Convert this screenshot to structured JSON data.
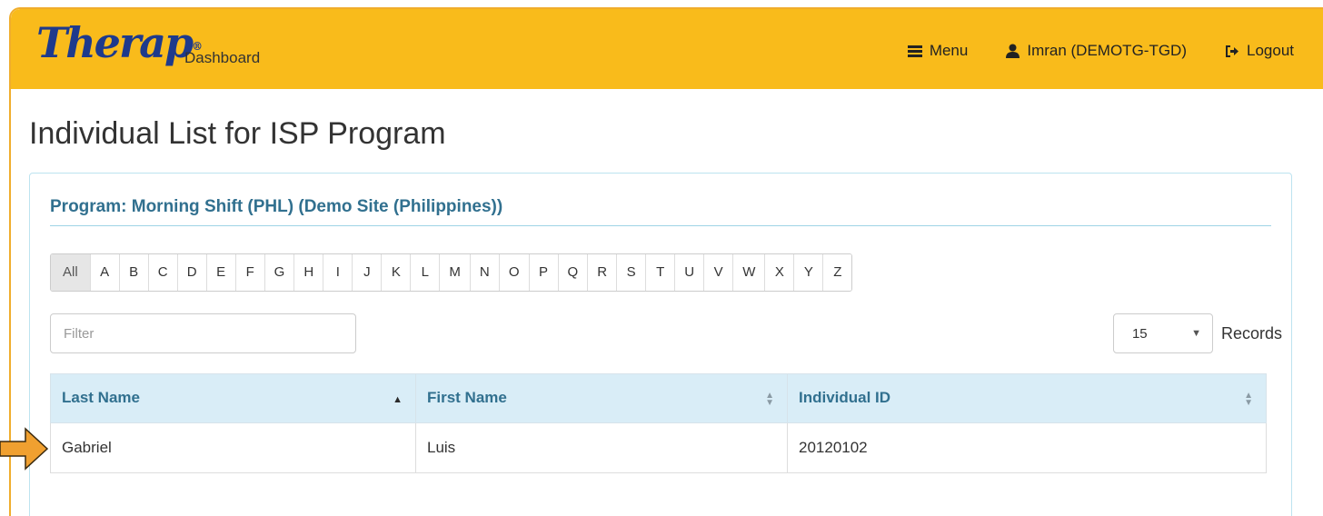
{
  "header": {
    "logo_text": "Therap",
    "logo_mark": "®",
    "dashboard_label": "Dashboard",
    "menu_label": "Menu",
    "user_label": "Imran (DEMOTG-TGD)",
    "logout_label": "Logout"
  },
  "page": {
    "title": "Individual List for ISP Program",
    "program_label": "Program: Morning Shift (PHL) (Demo Site (Philippines))"
  },
  "alphabet": [
    "All",
    "A",
    "B",
    "C",
    "D",
    "E",
    "F",
    "G",
    "H",
    "I",
    "J",
    "K",
    "L",
    "M",
    "N",
    "O",
    "P",
    "Q",
    "R",
    "S",
    "T",
    "U",
    "V",
    "W",
    "X",
    "Y",
    "Z"
  ],
  "filter": {
    "placeholder": "Filter",
    "value": ""
  },
  "records": {
    "selected": "15",
    "label": "Records"
  },
  "table": {
    "columns": [
      "Last Name",
      "First Name",
      "Individual ID"
    ],
    "rows": [
      [
        "Gabriel",
        "Luis",
        "20120102"
      ]
    ]
  },
  "colors": {
    "header_bg": "#f9bb1b",
    "logo": "#1e3a8c",
    "accent": "#31708f",
    "table_header_bg": "#d9edf7",
    "pointer_arrow": "#f0a030"
  },
  "icons": {
    "menu": "hamburger-icon",
    "user": "user-icon",
    "logout": "logout-icon",
    "sort_asc": "sort-asc-icon",
    "sort_both": "sort-both-icon",
    "pointer": "arrow-right-icon"
  }
}
